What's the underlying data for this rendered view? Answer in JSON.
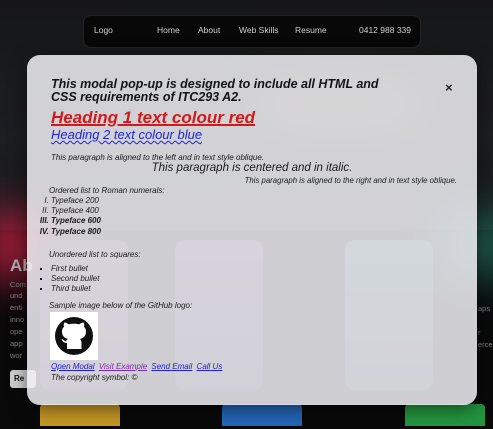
{
  "nav": {
    "logo": "Logo",
    "items": [
      "Home",
      "About",
      "Web Skills",
      "Resume"
    ],
    "phone": "0412 988 339"
  },
  "modal": {
    "title": "This modal pop-up is designed to include all HTML and CSS requirements of ITC293 A2.",
    "close_label": "×",
    "heading1": "Heading 1 text colour red",
    "heading2": "Heading 2 text colour blue",
    "para_left": "This paragraph is aligned to the left and in text style oblique.",
    "para_center": "This paragraph is centered and in italic.",
    "para_right": "This paragraph is aligned to the right and in text style oblique.",
    "ordered_label": "Ordered list to Roman numerals:",
    "ordered_items": [
      "Typeface 200",
      "Typeface 400",
      "Typeface 600",
      "Typeface 800"
    ],
    "unordered_label": "Unordered list to squares:",
    "unordered_items": [
      "First bullet",
      "Second bullet",
      "Third bullet"
    ],
    "image_label": "Sample image below of the GitHub logo:",
    "links": [
      "Open Modal",
      "Visit Example",
      "Send Email",
      "Call Us"
    ],
    "copyright": "The copyright symbol: ©"
  },
  "background_fragments": {
    "heading": "Ab",
    "button": "Re",
    "left_text": [
      "Com",
      "und",
      "enti",
      "inno",
      "ope",
      "app",
      "wor"
    ],
    "right_text": [
      "aps",
      "r",
      "erce"
    ]
  },
  "colors": {
    "heading1": "#d21a1a",
    "heading2": "#1c25e0",
    "link": "#2020d8",
    "link_visited": "#7a2aa8"
  },
  "icons": [
    "github-logo-icon",
    "close-icon"
  ]
}
